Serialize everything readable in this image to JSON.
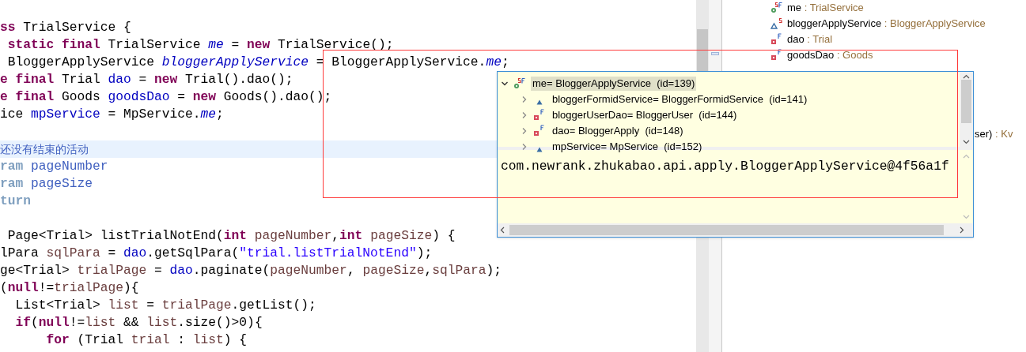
{
  "editor": {
    "blocks": [
      {
        "lines": [
          {
            "segments": [
              {
                "text": "ss",
                "kind": "keyword"
              },
              {
                "text": " TrialService {",
                "kind": "plain"
              }
            ]
          },
          {
            "segments": [
              {
                "text": " static final",
                "kind": "keyword"
              },
              {
                "text": " TrialService ",
                "kind": "plain"
              },
              {
                "text": "me",
                "kind": "static_field"
              },
              {
                "text": " = ",
                "kind": "plain"
              },
              {
                "text": "new",
                "kind": "keyword"
              },
              {
                "text": " TrialService();",
                "kind": "plain"
              }
            ]
          },
          {
            "segments": [
              {
                "text": " BloggerApplyService ",
                "kind": "plain"
              },
              {
                "text": "bloggerApplyService",
                "kind": "static_field"
              },
              {
                "text": " = BloggerApplyService.",
                "kind": "plain"
              },
              {
                "text": "me",
                "kind": "static_field"
              },
              {
                "text": ";",
                "kind": "plain"
              }
            ]
          },
          {
            "segments": [
              {
                "text": "e final",
                "kind": "keyword"
              },
              {
                "text": " Trial ",
                "kind": "plain"
              },
              {
                "text": "dao",
                "kind": "field"
              },
              {
                "text": " = ",
                "kind": "plain"
              },
              {
                "text": "new",
                "kind": "keyword"
              },
              {
                "text": " Trial().dao();",
                "kind": "plain"
              }
            ]
          },
          {
            "segments": [
              {
                "text": "e final",
                "kind": "keyword"
              },
              {
                "text": " Goods ",
                "kind": "plain"
              },
              {
                "text": "goodsDao",
                "kind": "field"
              },
              {
                "text": " = ",
                "kind": "plain"
              },
              {
                "text": "new",
                "kind": "keyword"
              },
              {
                "text": " Goods().dao();",
                "kind": "plain"
              }
            ]
          },
          {
            "segments": [
              {
                "text": "ice ",
                "kind": "plain"
              },
              {
                "text": "mpService",
                "kind": "field"
              },
              {
                "text": " = MpService.",
                "kind": "plain"
              },
              {
                "text": "me",
                "kind": "static_field"
              },
              {
                "text": ";",
                "kind": "plain"
              }
            ]
          }
        ]
      },
      {
        "lines": [
          {
            "highlighted": true,
            "segments": [
              {
                "text": "还没有结束的活动",
                "kind": "comment"
              }
            ]
          },
          {
            "segments": [
              {
                "text": "ram",
                "kind": "doc_tag"
              },
              {
                "text": " pageNumber",
                "kind": "doc"
              }
            ]
          },
          {
            "segments": [
              {
                "text": "ram",
                "kind": "doc_tag"
              },
              {
                "text": " pageSize",
                "kind": "doc"
              }
            ]
          },
          {
            "segments": [
              {
                "text": "turn",
                "kind": "doc_tag"
              }
            ]
          }
        ]
      },
      {
        "lines": [
          {
            "segments": [
              {
                "text": " Page<Trial> listTrialNotEnd(",
                "kind": "plain"
              },
              {
                "text": "int",
                "kind": "keyword"
              },
              {
                "text": " pageNumber",
                "kind": "local"
              },
              {
                "text": ",",
                "kind": "plain"
              },
              {
                "text": "int",
                "kind": "keyword"
              },
              {
                "text": " pageSize",
                "kind": "local"
              },
              {
                "text": ") {",
                "kind": "plain"
              }
            ]
          },
          {
            "segments": [
              {
                "text": "lPara ",
                "kind": "plain"
              },
              {
                "text": "sqlPara",
                "kind": "local"
              },
              {
                "text": " = ",
                "kind": "plain"
              },
              {
                "text": "dao",
                "kind": "field"
              },
              {
                "text": ".getSqlPara(",
                "kind": "plain"
              },
              {
                "text": "\"trial.listTrialNotEnd\"",
                "kind": "string"
              },
              {
                "text": ");",
                "kind": "plain"
              }
            ]
          },
          {
            "segments": [
              {
                "text": "ge<Trial> ",
                "kind": "plain"
              },
              {
                "text": "trialPage",
                "kind": "local"
              },
              {
                "text": " = ",
                "kind": "plain"
              },
              {
                "text": "dao",
                "kind": "field"
              },
              {
                "text": ".paginate(",
                "kind": "plain"
              },
              {
                "text": "pageNumber",
                "kind": "local"
              },
              {
                "text": ", ",
                "kind": "plain"
              },
              {
                "text": "pageSize",
                "kind": "local"
              },
              {
                "text": ",",
                "kind": "plain"
              },
              {
                "text": "sqlPara",
                "kind": "local"
              },
              {
                "text": ");",
                "kind": "plain"
              }
            ]
          },
          {
            "segments": [
              {
                "text": "(",
                "kind": "plain"
              },
              {
                "text": "null",
                "kind": "keyword"
              },
              {
                "text": "!=",
                "kind": "plain"
              },
              {
                "text": "trialPage",
                "kind": "local"
              },
              {
                "text": "){",
                "kind": "plain"
              }
            ]
          },
          {
            "segments": [
              {
                "text": "  List<Trial> ",
                "kind": "plain"
              },
              {
                "text": "list",
                "kind": "local"
              },
              {
                "text": " = ",
                "kind": "plain"
              },
              {
                "text": "trialPage",
                "kind": "local"
              },
              {
                "text": ".getList();",
                "kind": "plain"
              }
            ]
          },
          {
            "segments": [
              {
                "text": "  if",
                "kind": "keyword"
              },
              {
                "text": "(",
                "kind": "plain"
              },
              {
                "text": "null",
                "kind": "keyword"
              },
              {
                "text": "!=",
                "kind": "plain"
              },
              {
                "text": "list",
                "kind": "local"
              },
              {
                "text": " && ",
                "kind": "plain"
              },
              {
                "text": "list",
                "kind": "local"
              },
              {
                "text": ".size()>0){",
                "kind": "plain"
              }
            ]
          },
          {
            "segments": [
              {
                "text": "      for",
                "kind": "keyword"
              },
              {
                "text": " (Trial ",
                "kind": "plain"
              },
              {
                "text": "trial",
                "kind": "local"
              },
              {
                "text": " : ",
                "kind": "plain"
              },
              {
                "text": "list",
                "kind": "local"
              },
              {
                "text": ") {",
                "kind": "plain"
              }
            ]
          }
        ]
      }
    ]
  },
  "outline": {
    "items": [
      {
        "kind": "static_final",
        "name": "me",
        "type": ": TrialService"
      },
      {
        "kind": "package_static",
        "name": "bloggerApplyService",
        "type": ": BloggerApplyService"
      },
      {
        "kind": "private_final",
        "name": "dao",
        "type": ": Trial"
      },
      {
        "kind": "private_final",
        "name": "goodsDao",
        "type": ": Goods"
      }
    ],
    "partial_row": {
      "name": "ser)",
      "type": ": Kv"
    }
  },
  "hover": {
    "variables": [
      {
        "kind": "static_final",
        "label": "me= BloggerApplyService",
        "id": "(id=139)",
        "expanded": true,
        "selected": true,
        "children": [
          {
            "kind": "package",
            "label": "bloggerFormidService= BloggerFormidService",
            "id": "(id=141)",
            "expanded": false,
            "selected": false
          },
          {
            "kind": "private_final",
            "label": "bloggerUserDao= BloggerUser",
            "id": "(id=144)",
            "expanded": false,
            "selected": false
          },
          {
            "kind": "private_final",
            "label": "dao= BloggerApply",
            "id": "(id=148)",
            "expanded": false,
            "selected": false
          },
          {
            "kind": "package",
            "label": "mpService= MpService",
            "id": "(id=152)",
            "expanded": false,
            "selected": false
          }
        ]
      }
    ],
    "detail": "com.newrank.zhukabao.api.apply.BloggerApplyService@4f56a1f"
  }
}
